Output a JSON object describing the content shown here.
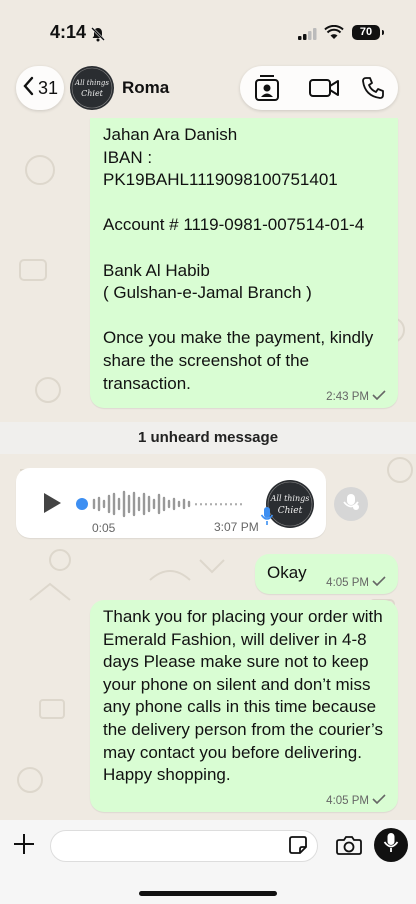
{
  "status_bar": {
    "time": "4:14",
    "battery": "70"
  },
  "header": {
    "back_count": "31",
    "contact_name": "Roma",
    "avatar_text_line1": "All things",
    "avatar_text_line2": "Chiet"
  },
  "messages": {
    "bank": {
      "text": " Jahan Ara Danish\nIBAN :\nPK19BAHL1119098100751401\n\nAccount #  1119-0981-007514-01-4\n\nBank Al Habib\n( Gulshan-e-Jamal Branch )\n\nOnce you make the payment, kindly share the screenshot of the transaction.",
      "time": "2:43 PM"
    },
    "unheard": "1 unheard message",
    "voice": {
      "duration": "0:05",
      "time": "3:07 PM"
    },
    "okay": {
      "text": "Okay",
      "time": "4:05 PM"
    },
    "thanks": {
      "text": "Thank you for placing your order with Emerald Fashion, will deliver in 4-8 days Please make sure not to keep your phone on silent and don’t miss any phone calls in this time because the delivery person from the courier’s may contact you before delivering. Happy shopping.",
      "time": "4:05 PM"
    }
  },
  "colors": {
    "outgoing_bubble": "#d9fdd3",
    "chat_bg": "#efeae2",
    "voice_dot": "#3d8ff2"
  }
}
